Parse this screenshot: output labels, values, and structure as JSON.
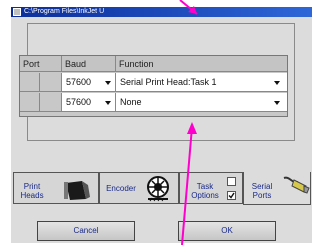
{
  "window": {
    "title": "C:\\Program Files\\InkJet  U"
  },
  "port_table": {
    "headers": [
      "Port",
      "Baud",
      "Function"
    ],
    "rows": [
      {
        "port": "",
        "baud": "57600",
        "function": "Serial Print Head:Task 1"
      },
      {
        "port": "",
        "baud": "57600",
        "function": "None"
      }
    ]
  },
  "tabs": {
    "print_heads": "Print Heads",
    "encoder": "Encoder",
    "task_options": "Task Options",
    "serial_ports": "Serial Ports"
  },
  "task_options": {
    "top_checked": false,
    "bottom_checked": true
  },
  "buttons": {
    "cancel": "Cancel",
    "ok": "OK"
  },
  "annotation_color": "#ff00cc"
}
